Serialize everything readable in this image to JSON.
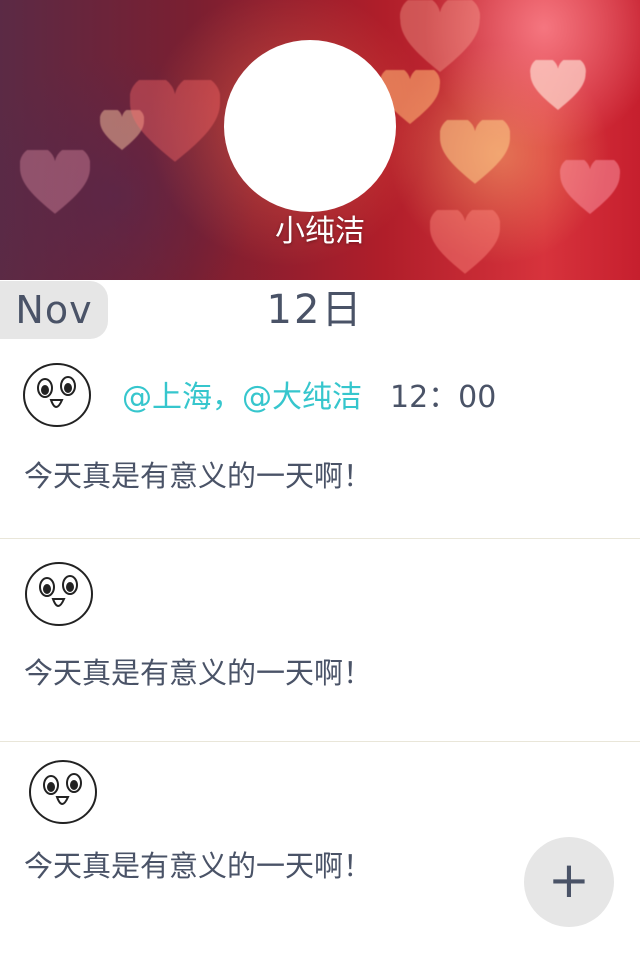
{
  "profile": {
    "username": "小纯洁"
  },
  "date": {
    "month": "Nov",
    "day": "12日"
  },
  "posts": [
    {
      "location": "@上海，@大纯洁",
      "time": "12：00",
      "text": "今天真是有意义的一天啊！",
      "avatar_icon": "cartoon-face-icon"
    },
    {
      "text": "今天真是有意义的一天啊！",
      "avatar_icon": "cartoon-face-icon"
    },
    {
      "text": "今天真是有意义的一天啊！",
      "avatar_icon": "cartoon-face-icon"
    }
  ],
  "fab": {
    "label": "+",
    "icon": "plus-icon"
  },
  "colors": {
    "accent": "#36c6cd",
    "text": "#4a5367",
    "tab_bg": "#e6e6e6",
    "divider": "#e9e6d9"
  }
}
